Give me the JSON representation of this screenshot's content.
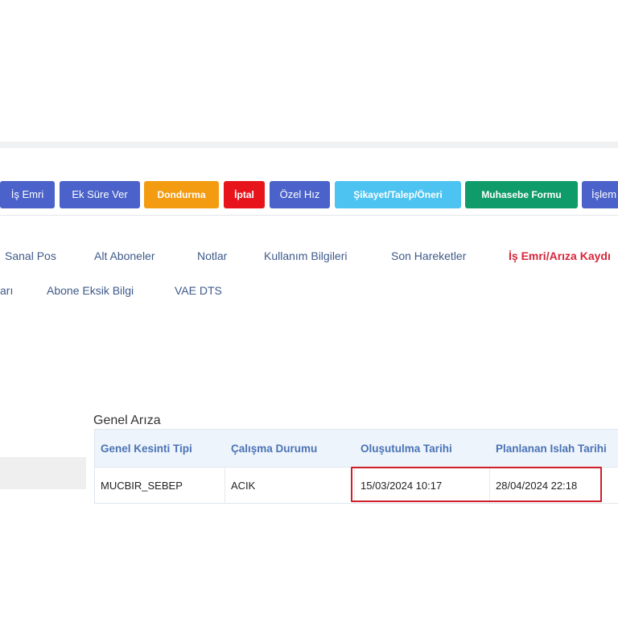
{
  "toolbar": {
    "buttons": [
      {
        "label": "İş Emri",
        "color": "#4a62c9"
      },
      {
        "label": "Ek Süre Ver",
        "color": "#4a62c9"
      },
      {
        "label": "Dondurma",
        "color": "#f39c12"
      },
      {
        "label": "İptal",
        "color": "#e8141b"
      },
      {
        "label": "Özel Hız",
        "color": "#4a62c9"
      },
      {
        "label": "Şikayet/Talep/Öneri",
        "color": "#4cc3f0"
      },
      {
        "label": "Muhasebe Formu",
        "color": "#109c6a"
      },
      {
        "label": "İşlem",
        "color": "#4a62c9"
      }
    ]
  },
  "tabs": {
    "row1": [
      {
        "label": "Sanal Pos"
      },
      {
        "label": "Alt Aboneler"
      },
      {
        "label": "Notlar"
      },
      {
        "label": "Kullanım Bilgileri"
      },
      {
        "label": "Son Hareketler"
      },
      {
        "label": "İş Emri/Arıza Kaydı",
        "active": true
      }
    ],
    "row2": [
      {
        "label": "arı"
      },
      {
        "label": "Abone Eksik Bilgi"
      },
      {
        "label": "VAE DTS"
      }
    ]
  },
  "section": {
    "title": "Genel Arıza"
  },
  "table": {
    "columns": [
      "Genel Kesinti Tipi",
      "Çalışma Durumu",
      "Oluşutulma Tarihi",
      "Planlanan Islah Tarihi"
    ],
    "rows": [
      [
        "MUCBIR_SEBEP",
        "ACIK",
        "15/03/2024 10:17",
        "28/04/2024 22:18"
      ]
    ]
  },
  "colors": {
    "highlight": "#cf1f2a",
    "active_tab": "#d6263a",
    "header_text": "#4a73b5"
  }
}
